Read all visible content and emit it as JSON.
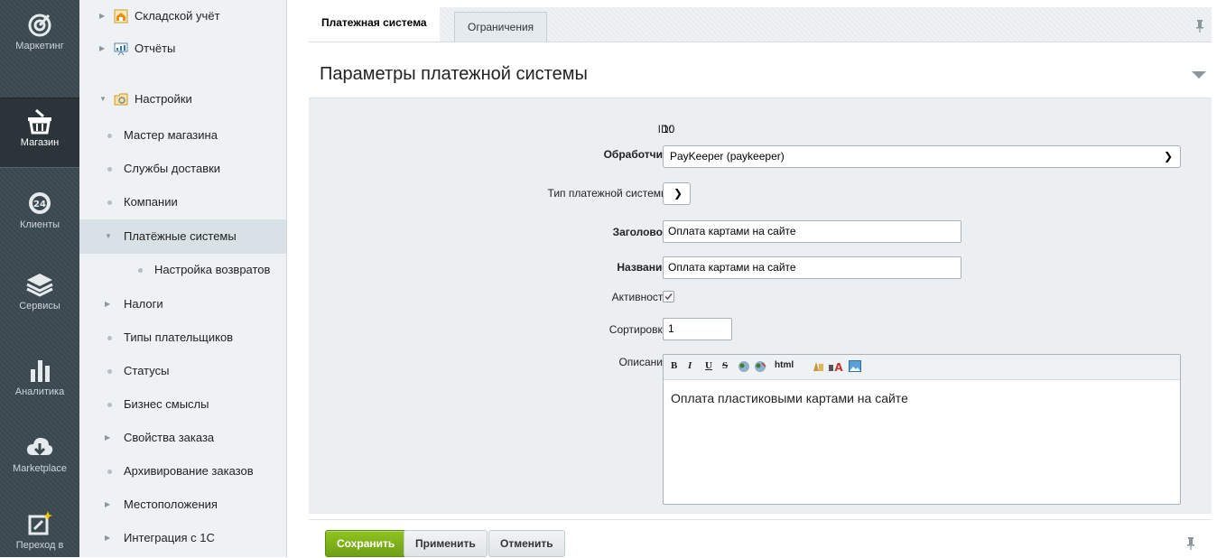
{
  "rail": {
    "items": [
      {
        "label": "Маркетинг",
        "icon": "target-icon"
      },
      {
        "label": "Магазин",
        "icon": "basket-icon"
      },
      {
        "label": "Клиенты",
        "icon": "clock-24-icon"
      },
      {
        "label": "Сервисы",
        "icon": "layers-icon"
      },
      {
        "label": "Аналитика",
        "icon": "bar-chart-icon"
      },
      {
        "label": "Marketplace",
        "icon": "cloud-download-icon"
      },
      {
        "label": "Переход в",
        "icon": "edit-sparkle-icon"
      }
    ]
  },
  "tree": {
    "items": [
      {
        "label": "Складской учёт",
        "kind": "folder-collapsed",
        "icon": "warehouse-icon"
      },
      {
        "label": "Отчёты",
        "kind": "folder-collapsed",
        "icon": "reports-icon"
      },
      {
        "label": "Настройки",
        "kind": "folder-expanded",
        "icon": "settings-folder-icon"
      },
      {
        "label": "Мастер магазина",
        "kind": "leaf"
      },
      {
        "label": "Службы доставки",
        "kind": "leaf"
      },
      {
        "label": "Компании",
        "kind": "leaf"
      },
      {
        "label": "Платёжные системы",
        "kind": "expanded",
        "selected": true
      },
      {
        "label": "Настройка возвратов",
        "kind": "leaf-deep"
      },
      {
        "label": "Налоги",
        "kind": "collapsed"
      },
      {
        "label": "Типы плательщиков",
        "kind": "leaf"
      },
      {
        "label": "Статусы",
        "kind": "leaf"
      },
      {
        "label": "Бизнес смыслы",
        "kind": "leaf"
      },
      {
        "label": "Свойства заказа",
        "kind": "collapsed"
      },
      {
        "label": "Архивирование заказов",
        "kind": "leaf"
      },
      {
        "label": "Местоположения",
        "kind": "collapsed"
      },
      {
        "label": "Интеграция с 1С",
        "kind": "collapsed"
      }
    ]
  },
  "tabs": [
    {
      "label": "Платежная система",
      "active": true
    },
    {
      "label": "Ограничения",
      "active": false
    }
  ],
  "section": {
    "title": "Параметры платежной системы"
  },
  "form": {
    "id_label": "ID:",
    "id_value": "10",
    "handler_label": "Обработчик:",
    "handler_value": "PayKeeper (paykeeper)",
    "ps_type_label": "Тип платежной системы:",
    "ps_type_value": "",
    "caption_label": "Заголовок:",
    "caption_value": "Оплата картами на сайте",
    "name_label": "Название:",
    "name_value": "Оплата картами на сайте",
    "active_label": "Активность:",
    "active_checked": true,
    "sort_label": "Сортировка:",
    "sort_value": "1",
    "description_label": "Описание:",
    "description_value": "Оплата пластиковыми картами на сайте",
    "editor_toolbar": [
      "B",
      "I",
      "U",
      "S",
      "html"
    ]
  },
  "footer": {
    "save": "Сохранить",
    "apply": "Применить",
    "cancel": "Отменить"
  },
  "colors": {
    "rail_bg": "#3b4a52",
    "tree_bg": "#eef2f4",
    "form_bg": "#ebeff1",
    "save_green": "#7fb21b"
  }
}
